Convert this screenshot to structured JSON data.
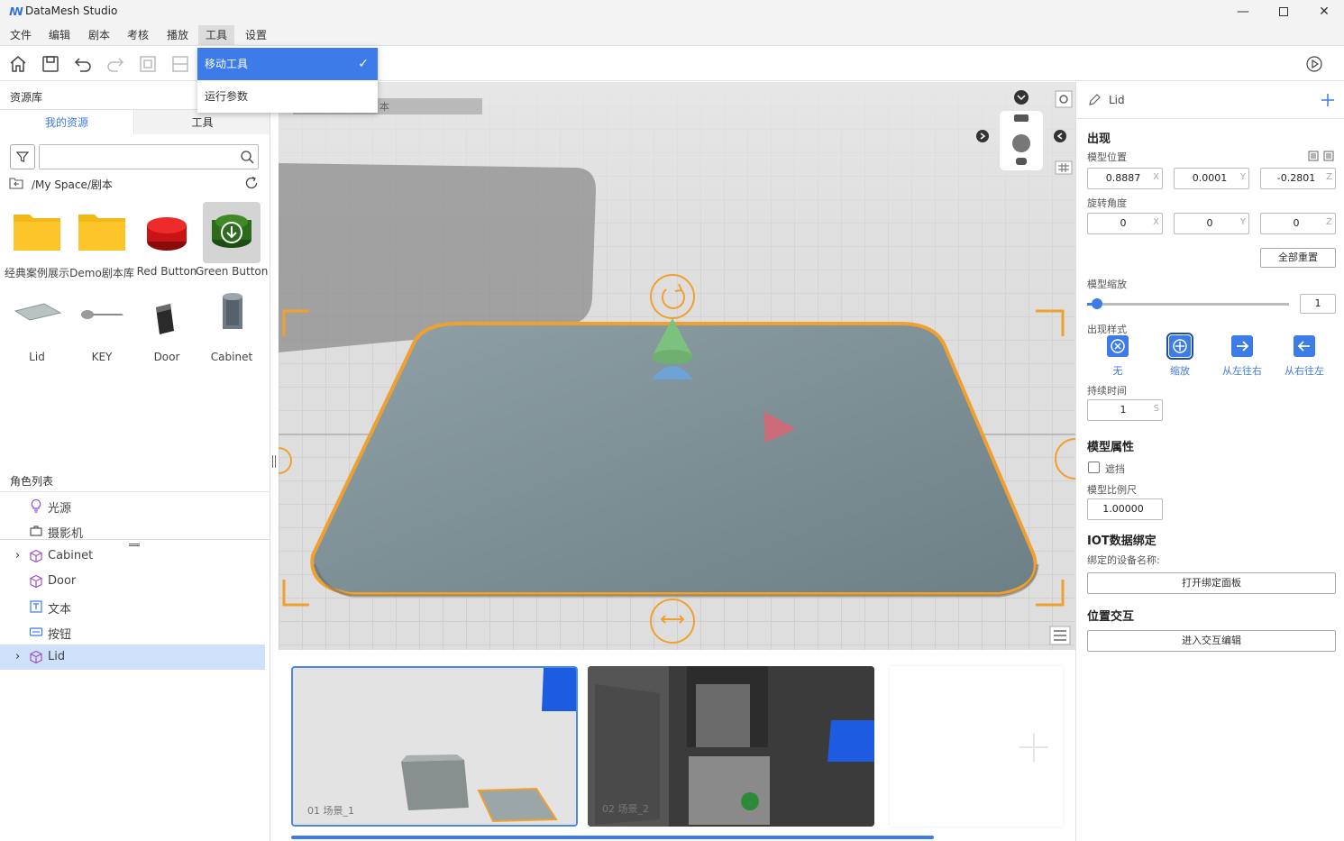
{
  "app": {
    "title": "DataMesh Studio"
  },
  "menu": [
    "文件",
    "编辑",
    "剧本",
    "考核",
    "播放",
    "工具",
    "设置"
  ],
  "dropdown": {
    "items": [
      "移动工具",
      "运行参数"
    ],
    "check": "✓"
  },
  "left": {
    "library_title": "资源库",
    "tabs": [
      "我的资源",
      "工具"
    ],
    "search_placeholder": "",
    "path": "/My Space/剧本",
    "assets": [
      "经典案例展示",
      "Demo剧本库",
      "Red Button",
      "Green Button",
      "Lid",
      "KEY",
      "Door",
      "Cabinet"
    ],
    "role_title": "角色列表",
    "roles": [
      "光源",
      "摄影机",
      "Cabinet",
      "Door",
      "文本",
      "按钮",
      "Lid"
    ]
  },
  "viewport": {
    "label": "本"
  },
  "scenes": [
    "01  场景_1",
    "02  场景_2"
  ],
  "right": {
    "object_name": "Lid",
    "appear": "出现",
    "position_label": "模型位置",
    "position": {
      "x": "0.8887",
      "y": "0.0001",
      "z": "-0.2801"
    },
    "axes": [
      "X",
      "Y",
      "Z"
    ],
    "rotation_label": "旋转角度",
    "rotation": {
      "x": "0",
      "y": "0",
      "z": "0"
    },
    "reset_all": "全部重置",
    "scale_label": "模型缩放",
    "scale_value": "1",
    "scale_fraction": 0.05,
    "style_label": "出现样式",
    "styles": [
      "无",
      "缩放",
      "从左往右",
      "从右往左"
    ],
    "duration_label": "持续时间",
    "duration": "1",
    "duration_unit": "S",
    "model_props": "模型属性",
    "occlusion": "遮挡",
    "ratio_label": "模型比例尺",
    "ratio": "1.00000",
    "iot_title": "IOT数据绑定",
    "iot_device_label": "绑定的设备名称:",
    "iot_button": "打开绑定面板",
    "interaction_title": "位置交互",
    "interaction_button": "进入交互编辑"
  },
  "colors": {
    "accent": "#3d7be8",
    "selection_outline": "#f0a030"
  }
}
